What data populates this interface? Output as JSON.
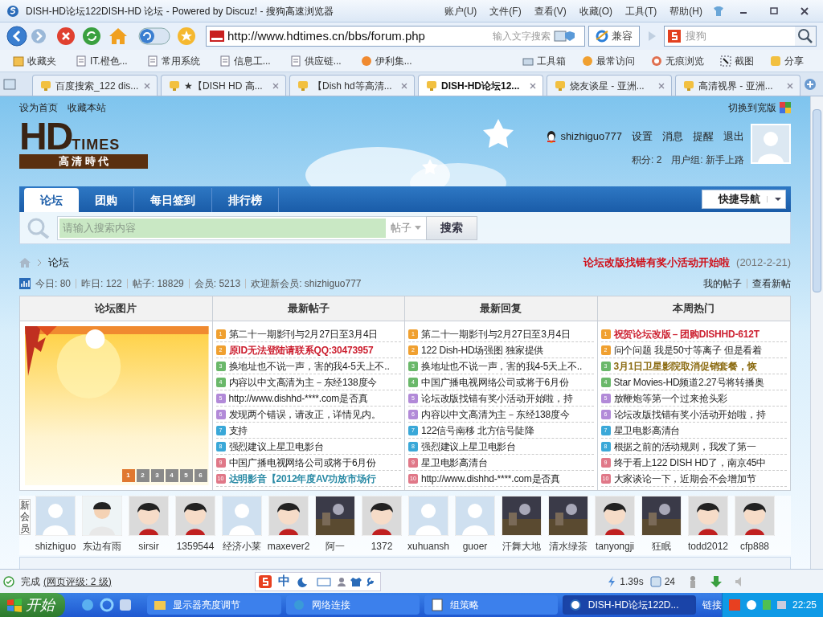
{
  "window": {
    "title": "DISH-HD论坛122DISH-HD 论坛 - Powered by Discuz! - 搜狗高速浏览器",
    "menu": [
      "账户(U)",
      "文件(F)",
      "查看(V)",
      "收藏(O)",
      "工具(T)",
      "帮助(H)"
    ]
  },
  "toolbar": {
    "address": "http://www.hdtimes.cn/bbs/forum.php",
    "inline_search_placeholder": "输入文字搜索",
    "compat": "兼容",
    "search_placeholder": "搜狗"
  },
  "favorites": {
    "left": [
      "收藏夹",
      "IT.橙色...",
      "常用系统",
      "信息工...",
      "供应链...",
      "伊利集..."
    ],
    "right": [
      "工具箱",
      "最常访问",
      "无痕浏览",
      "截图",
      "分享"
    ]
  },
  "tabs": [
    {
      "label": "百度搜索_122 dis...",
      "selected": false
    },
    {
      "label": "★【DISH HD 高...",
      "selected": false
    },
    {
      "label": "【Dish hd等高清...",
      "selected": false
    },
    {
      "label": "DISH-HD论坛12...",
      "selected": true
    },
    {
      "label": "烧友谈星 - 亚洲...",
      "selected": false
    },
    {
      "label": "高清视界 - 亚洲...",
      "selected": false
    }
  ],
  "page": {
    "top_links": [
      "设为首页",
      "收藏本站"
    ],
    "wide_switch": "切换到宽版",
    "logo": {
      "main": "HD",
      "sub": "TIMES",
      "tagline": "高 清 時 代"
    },
    "user": {
      "name": "shizhiguo777",
      "links": [
        "设置",
        "消息",
        "提醒",
        "退出"
      ],
      "points": "积分: 2",
      "group": "用户组: 新手上路"
    },
    "nav": [
      {
        "label": "论坛",
        "selected": true
      },
      {
        "label": "团购",
        "selected": false
      },
      {
        "label": "每日签到",
        "selected": false
      },
      {
        "label": "排行榜",
        "selected": false
      }
    ],
    "quick_nav": "快捷导航",
    "search": {
      "placeholder": "请输入搜索内容",
      "scope": "帖子",
      "button": "搜索"
    },
    "breadcrumb": "论坛",
    "notice": {
      "title": "论坛改版找错有奖小活动开始啦",
      "date": "(2012-2-21)"
    },
    "stats": [
      "今日: 80",
      "昨日: 122",
      "帖子: 18829",
      "会员: 5213",
      "欢迎新会员: shizhiguo777"
    ],
    "my_links": [
      "我的帖子",
      "查看新帖"
    ],
    "table": {
      "columns": [
        "论坛图片",
        "最新帖子",
        "最新回复",
        "本周热门"
      ],
      "slides": [
        {
          "label": "1",
          "selected": true
        },
        {
          "label": "2",
          "selected": false
        },
        {
          "label": "3",
          "selected": false
        },
        {
          "label": "4",
          "selected": false
        },
        {
          "label": "5",
          "selected": false
        },
        {
          "label": "6",
          "selected": false
        }
      ],
      "lists": [
        [
          {
            "n": "1",
            "title": "第二十一期影刊与2月27日至3月4日"
          },
          {
            "n": "2",
            "title": "原ID无法登陆请联系QQ:30473957",
            "color": "#cc1f2f"
          },
          {
            "n": "3",
            "title": "换地址也不说一声，害的我4-5天上不.."
          },
          {
            "n": "4",
            "title": "内容以中文高清为主－东经138度今"
          },
          {
            "n": "5",
            "title": "http://www.dishhd-****.com是否真"
          },
          {
            "n": "6",
            "title": "发现两个错误，请改正，详情见内。"
          },
          {
            "n": "7",
            "title": "支持"
          },
          {
            "n": "8",
            "title": "强烈建议上星卫电影台"
          },
          {
            "n": "9",
            "title": "中国广播电视网络公司或将于6月份"
          },
          {
            "n": "10",
            "title": "达明影音【2012年度AV功放市场行",
            "color": "#2a8aa5"
          }
        ],
        [
          {
            "n": "1",
            "title": "第二十一期影刊与2月27日至3月4日"
          },
          {
            "n": "2",
            "title": "122 Dish-HD场强图 独家提供"
          },
          {
            "n": "3",
            "title": "换地址也不说一声，害的我4-5天上不.."
          },
          {
            "n": "4",
            "title": "中国广播电视网络公司或将于6月份"
          },
          {
            "n": "5",
            "title": "论坛改版找错有奖小活动开始啦，持"
          },
          {
            "n": "6",
            "title": "内容以中文高清为主－东经138度今"
          },
          {
            "n": "7",
            "title": "122信号南移 北方信号陡降"
          },
          {
            "n": "8",
            "title": "强烈建议上星卫电影台"
          },
          {
            "n": "9",
            "title": "星卫电影高清台"
          },
          {
            "n": "10",
            "title": "http://www.dishhd-****.com是否真"
          }
        ],
        [
          {
            "n": "1",
            "title": "祝贺论坛改版－团购DISHHD-612T",
            "color": "#cc1f2f"
          },
          {
            "n": "2",
            "title": "问个问题 我是50寸等离子 但是看着"
          },
          {
            "n": "3",
            "title": "3月1日卫星影院取消促销套餐，恢",
            "color": "#8a6a10"
          },
          {
            "n": "4",
            "title": "Star Movies-HD频道2.27号将转播奥"
          },
          {
            "n": "5",
            "title": "放鞭炮等第一个过来抢头彩"
          },
          {
            "n": "6",
            "title": "论坛改版找错有奖小活动开始啦，持"
          },
          {
            "n": "7",
            "title": "星卫电影高清台"
          },
          {
            "n": "8",
            "title": "根据之前的活动规则，我发了第一"
          },
          {
            "n": "9",
            "title": "终于看上122 DISH HD了，南京45中"
          },
          {
            "n": "10",
            "title": "大家谈论一下，近期会不会增加节"
          }
        ]
      ]
    },
    "members_label": "新会员",
    "members": [
      {
        "name": "shizhiguo",
        "kind": "default"
      },
      {
        "name": "东边有雨",
        "kind": "figure"
      },
      {
        "name": "sirsir",
        "kind": "cartoon"
      },
      {
        "name": "1359544",
        "kind": "cartoon"
      },
      {
        "name": "经济小莱",
        "kind": "default"
      },
      {
        "name": "maxever2",
        "kind": "cartoon"
      },
      {
        "name": "阿一"
      },
      {
        "name": "1372",
        "kind": "cartoon"
      },
      {
        "name": "xuhuansh",
        "kind": "default"
      },
      {
        "name": "guoer",
        "kind": "default"
      },
      {
        "name": "汗舞大地"
      },
      {
        "name": "清水绿茶"
      },
      {
        "name": "tanyongji",
        "kind": "cartoon"
      },
      {
        "name": "狂眠"
      },
      {
        "name": "todd2012",
        "kind": "cartoon"
      },
      {
        "name": "cfp888",
        "kind": "cartoon"
      }
    ]
  },
  "status_bar": {
    "state": "完成",
    "rating": "(网页评级: 2 级)",
    "ime": "中",
    "time": "1.39s",
    "count": "24"
  },
  "taskbar": {
    "start": "开始",
    "items": [
      {
        "label": "显示器亮度调节",
        "selected": false
      },
      {
        "label": "网络连接",
        "selected": false
      },
      {
        "label": "组策略",
        "selected": false
      },
      {
        "label": "DISH-HD论坛122D...",
        "selected": true
      }
    ],
    "links": "链接",
    "clock": "22:25"
  }
}
